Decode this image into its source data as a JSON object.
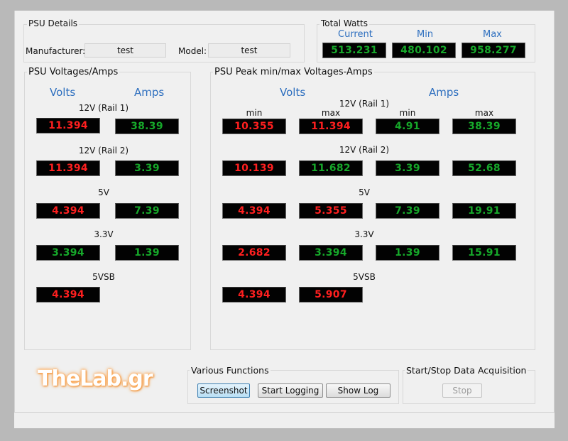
{
  "psu_details": {
    "title": "PSU Details",
    "manufacturer_label": "Manufacturer:",
    "manufacturer_value": "test",
    "model_label": "Model:",
    "model_value": "test"
  },
  "total_watts": {
    "title": "Total Watts",
    "current_label": "Current",
    "min_label": "Min",
    "max_label": "Max",
    "current": "513.231",
    "min": "480.102",
    "max": "958.277"
  },
  "voltages_amps": {
    "title": "PSU Voltages/Amps",
    "volts_header": "Volts",
    "amps_header": "Amps",
    "rails": [
      {
        "name": "12V (Rail 1)",
        "volts": "11.394",
        "amps": "38.39"
      },
      {
        "name": "12V (Rail 2)",
        "volts": "11.394",
        "amps": "3.39"
      },
      {
        "name": "5V",
        "volts": "4.394",
        "amps": "7.39"
      },
      {
        "name": "3.3V",
        "volts": "3.394",
        "amps": "1.39"
      },
      {
        "name": "5VSB",
        "volts": "4.394"
      }
    ]
  },
  "peak": {
    "title": "PSU Peak min/max Voltages-Amps",
    "volts_header": "Volts",
    "amps_header": "Amps",
    "min_label": "min",
    "max_label": "max",
    "rails": [
      {
        "name": "12V (Rail 1)",
        "vmin": "10.355",
        "vmax": "11.394",
        "amin": "4.91",
        "amax": "38.39"
      },
      {
        "name": "12V (Rail 2)",
        "vmin": "10.139",
        "vmax": "11.682",
        "amin": "3.39",
        "amax": "52.68"
      },
      {
        "name": "5V",
        "vmin": "4.394",
        "vmax": "5.355",
        "amin": "7.39",
        "amax": "19.91"
      },
      {
        "name": "3.3V",
        "vmin": "2.682",
        "vmax": "3.394",
        "amin": "1.39",
        "amax": "15.91"
      },
      {
        "name": "5VSB",
        "vmin": "4.394",
        "vmax": "5.907"
      }
    ]
  },
  "logo": {
    "text_main": "TheLab",
    "text_tld": ".gr"
  },
  "functions": {
    "title": "Various Functions",
    "screenshot_label": "Screenshot",
    "start_logging_label": "Start Logging",
    "show_log_label": "Show Log"
  },
  "acquisition": {
    "title": "Start/Stop Data Acquisition",
    "stop_label": "Stop"
  },
  "colors": {
    "display_red": "#ff1f1f",
    "display_green": "#16a82a",
    "header_blue": "#2e6fbf"
  }
}
